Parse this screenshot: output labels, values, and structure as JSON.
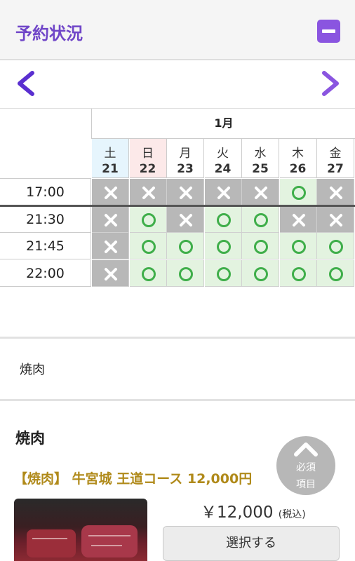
{
  "header": {
    "title": "予約状況"
  },
  "calendar": {
    "month": "1月",
    "days": [
      {
        "weekday": "土",
        "date": "21",
        "bg": "#e6f5fd"
      },
      {
        "weekday": "日",
        "date": "22",
        "bg": "#fce9e9"
      },
      {
        "weekday": "月",
        "date": "23",
        "bg": "#ffffff"
      },
      {
        "weekday": "火",
        "date": "24",
        "bg": "#ffffff"
      },
      {
        "weekday": "水",
        "date": "25",
        "bg": "#ffffff"
      },
      {
        "weekday": "木",
        "date": "26",
        "bg": "#ffffff"
      },
      {
        "weekday": "金",
        "date": "27",
        "bg": "#ffffff"
      }
    ],
    "times": [
      "17:00",
      "21:30",
      "21:45",
      "22:00"
    ],
    "availability": [
      [
        "x",
        "x",
        "x",
        "x",
        "x",
        "o",
        "x"
      ],
      [
        "x",
        "o",
        "x",
        "o",
        "o",
        "x",
        "x"
      ],
      [
        "x",
        "o",
        "o",
        "o",
        "o",
        "o",
        "o"
      ],
      [
        "x",
        "o",
        "o",
        "o",
        "o",
        "o",
        "o"
      ]
    ]
  },
  "category": {
    "label": "焼肉"
  },
  "course_section": {
    "title": "焼肉",
    "course_name": "【焼肉】 牛宮城 王道コース 12,000円",
    "price": "￥12,000",
    "tax_note": "(税込)",
    "select_label": "選択する"
  },
  "required_badge": {
    "line1": "必須",
    "line2": "項目"
  },
  "colors": {
    "accent": "#7046c8",
    "available": "#3fae4a",
    "unavailable_bg": "#b8b8b8",
    "course_gold": "#b08a1a"
  }
}
